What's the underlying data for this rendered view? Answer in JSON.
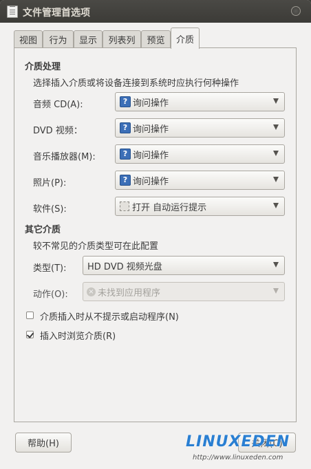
{
  "window": {
    "title": "文件管理首选项"
  },
  "tabs": [
    {
      "label": "视图"
    },
    {
      "label": "行为"
    },
    {
      "label": "显示"
    },
    {
      "label": "列表列"
    },
    {
      "label": "预览"
    },
    {
      "label": "介质",
      "active": true
    }
  ],
  "media_handling": {
    "heading": "介质处理",
    "description": "选择插入介质或将设备连接到系统时应执行何种操作",
    "rows": [
      {
        "label": "音频 CD(A):",
        "value": "询问操作",
        "icon": "question-icon"
      },
      {
        "label": "DVD 视频：",
        "value": "询问操作",
        "icon": "question-icon"
      },
      {
        "label": "音乐播放器(M):",
        "value": "询问操作",
        "icon": "question-icon"
      },
      {
        "label": "照片(P):",
        "value": "询问操作",
        "icon": "question-icon"
      },
      {
        "label": "软件(S):",
        "value": "打开 自动运行提示",
        "icon": "puzzle-icon"
      }
    ]
  },
  "other_media": {
    "heading": "其它介质",
    "description": "较不常见的介质类型可在此配置",
    "type_label": "类型(T):",
    "type_value": "HD DVD 视频光盘",
    "action_label": "动作(O):",
    "action_value": "未找到应用程序"
  },
  "options": {
    "never_prompt": {
      "label": "介质插入时从不提示或启动程序(N)",
      "checked": false
    },
    "browse_on_insert": {
      "label": "插入时浏览介质(R)",
      "checked": true
    }
  },
  "buttons": {
    "help": "帮助(H)",
    "close": "关闭(C)"
  },
  "watermark": {
    "brand": "LINUXEDEN",
    "url": "http://www.linuxeden.com"
  },
  "colors": {
    "titlebar": "#3c3b37",
    "window_bg": "#f2f1f0",
    "question_icon": "#3c6fb7",
    "watermark": "#2a7fd2"
  }
}
